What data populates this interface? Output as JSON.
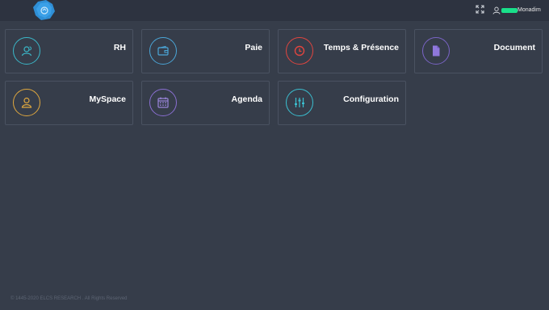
{
  "header": {
    "user": {
      "name": "Monadim"
    }
  },
  "modules": [
    {
      "label": "RH",
      "icon": "user-circle-icon",
      "color": "#3bb8c9"
    },
    {
      "label": "Paie",
      "icon": "wallet-icon",
      "color": "#4ba6d8"
    },
    {
      "label": "Temps & Présence",
      "icon": "clock-icon",
      "color": "#e0453f"
    },
    {
      "label": "Document",
      "icon": "document-icon",
      "color": "#7a64c6"
    },
    {
      "label": "MySpace",
      "icon": "user-icon",
      "color": "#e0a83f"
    },
    {
      "label": "Agenda",
      "icon": "calendar-icon",
      "color": "#8a6fd2"
    },
    {
      "label": "Configuration",
      "icon": "sliders-icon",
      "color": "#3bbfd0"
    }
  ],
  "footer": {
    "text": "© 1445-2020 ELCS RESEARCH . All Rights Reserved"
  },
  "colors": {
    "background": "#363d4a",
    "topbar": "#2d3340",
    "tile_border": "#4a5261",
    "logo": "#2f8fd6",
    "redaction": "#19e08a"
  }
}
